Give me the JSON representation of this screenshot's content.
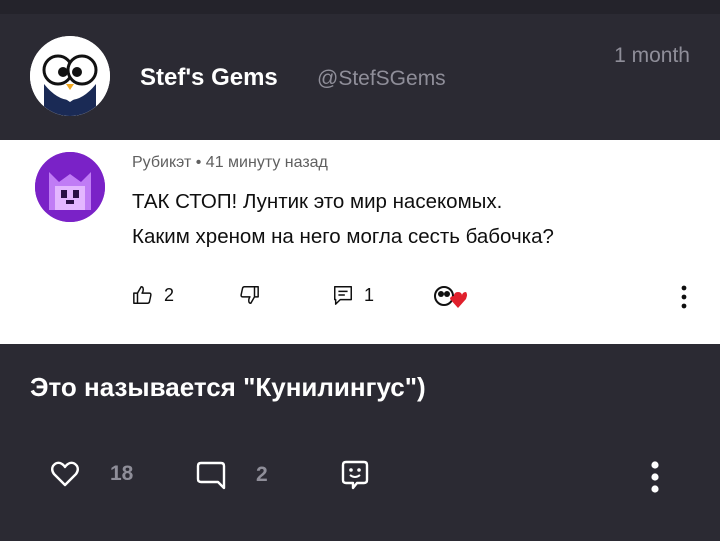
{
  "post": {
    "author": "Stef's Gems",
    "handle": "@StefSGems",
    "time": "1 month"
  },
  "embedded_comment": {
    "author": "Рубикэт",
    "separator": "•",
    "time": "41 минуту назад",
    "lines": [
      "ТАК СТОП! Лунтик это мир насекомых.",
      "Каким хреном на него могла сесть бабочка?"
    ],
    "likes": "2",
    "replies": "1"
  },
  "reply": {
    "text": "Это называется \"Кунилингус\")"
  },
  "actions": {
    "likes": "18",
    "comments": "2"
  },
  "colors": {
    "background": "#2b2a33",
    "muted": "#8f8e99",
    "heart": "#e0202c"
  }
}
